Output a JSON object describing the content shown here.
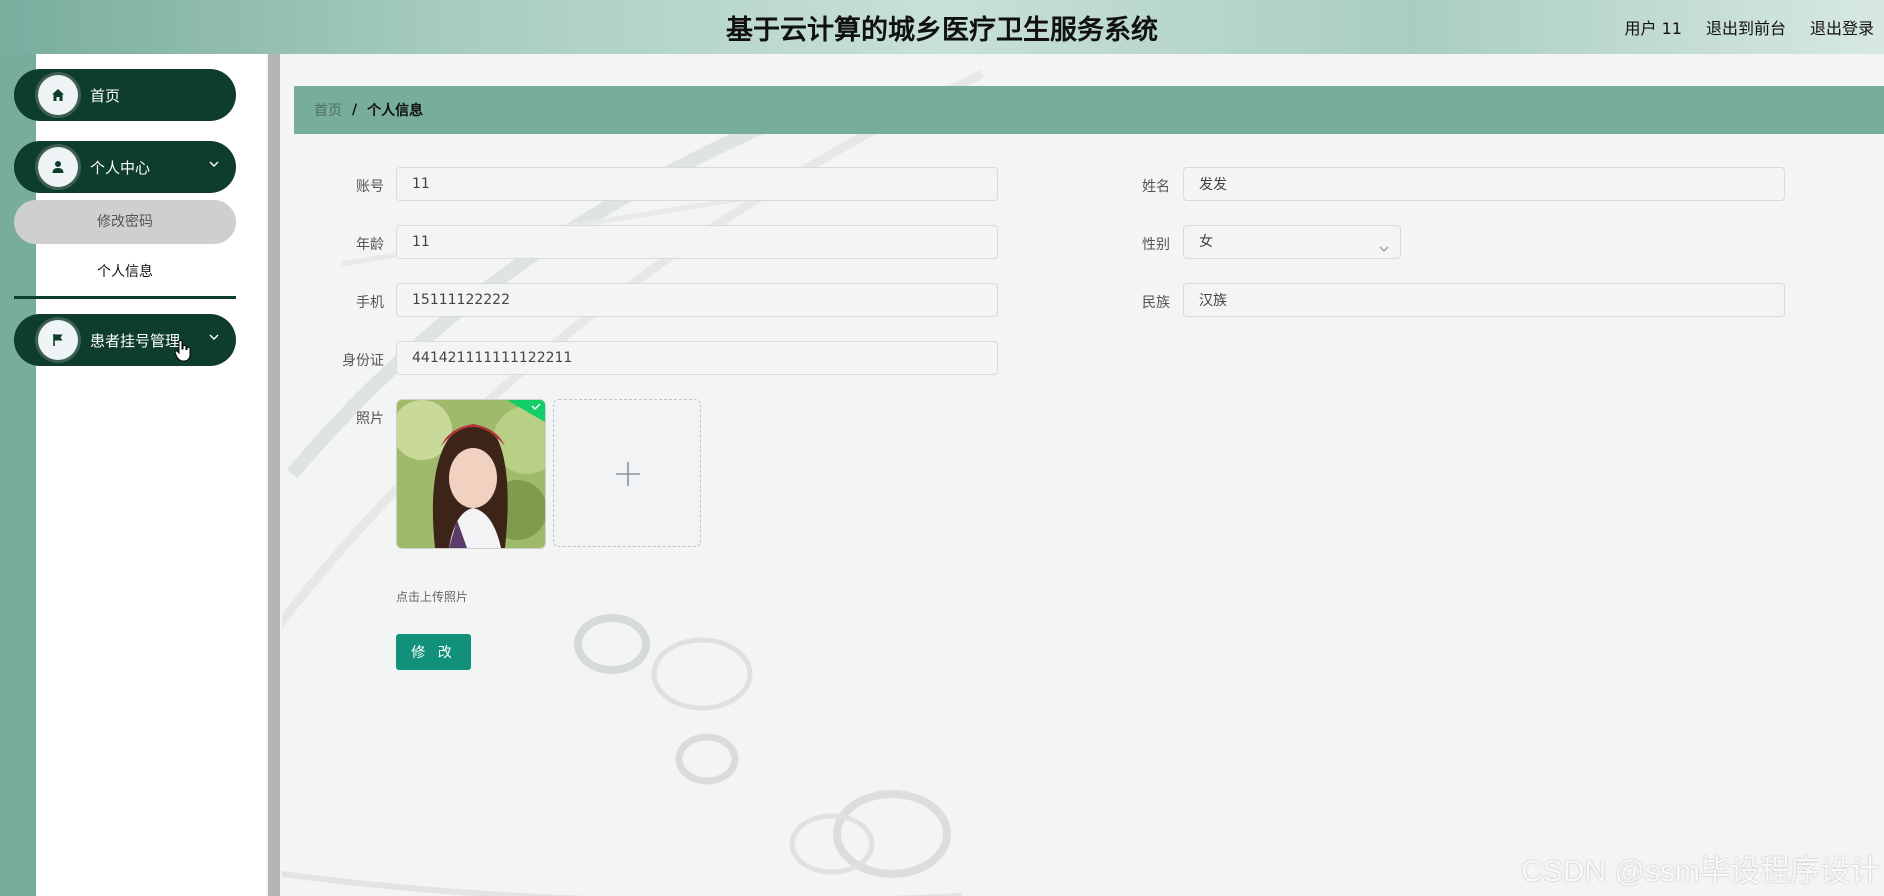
{
  "header": {
    "title": "基于云计算的城乡医疗卫生服务系统",
    "user_label": "用户 11",
    "to_frontend": "退出到前台",
    "logout": "退出登录"
  },
  "sidebar": {
    "items": [
      {
        "label": "首页",
        "icon": "home-icon"
      },
      {
        "label": "个人中心",
        "icon": "user-icon",
        "expanded": true,
        "children": [
          {
            "label": "修改密码"
          },
          {
            "label": "个人信息",
            "active": true
          }
        ]
      },
      {
        "label": "患者挂号管理",
        "icon": "flag-icon",
        "expanded": false
      }
    ]
  },
  "breadcrumb": {
    "home": "首页",
    "separator": "/",
    "current": "个人信息"
  },
  "form": {
    "account_label": "账号",
    "account_value": "11",
    "name_label": "姓名",
    "name_value": "发发",
    "age_label": "年龄",
    "age_value": "11",
    "gender_label": "性别",
    "gender_value": "女",
    "phone_label": "手机",
    "phone_value": "15111122222",
    "ethnicity_label": "民族",
    "ethnicity_value": "汉族",
    "idcard_label": "身份证",
    "idcard_value": "441421111111122211",
    "photo_label": "照片",
    "upload_hint": "点击上传照片",
    "submit_label": "修 改"
  },
  "watermark": "CSDN @ssm毕设程序设计",
  "colors": {
    "header_green": "#79ad9e",
    "sidebar_dark": "#0f3d2b",
    "breadcrumb_bg": "#78ad9e",
    "button": "#12917a"
  }
}
